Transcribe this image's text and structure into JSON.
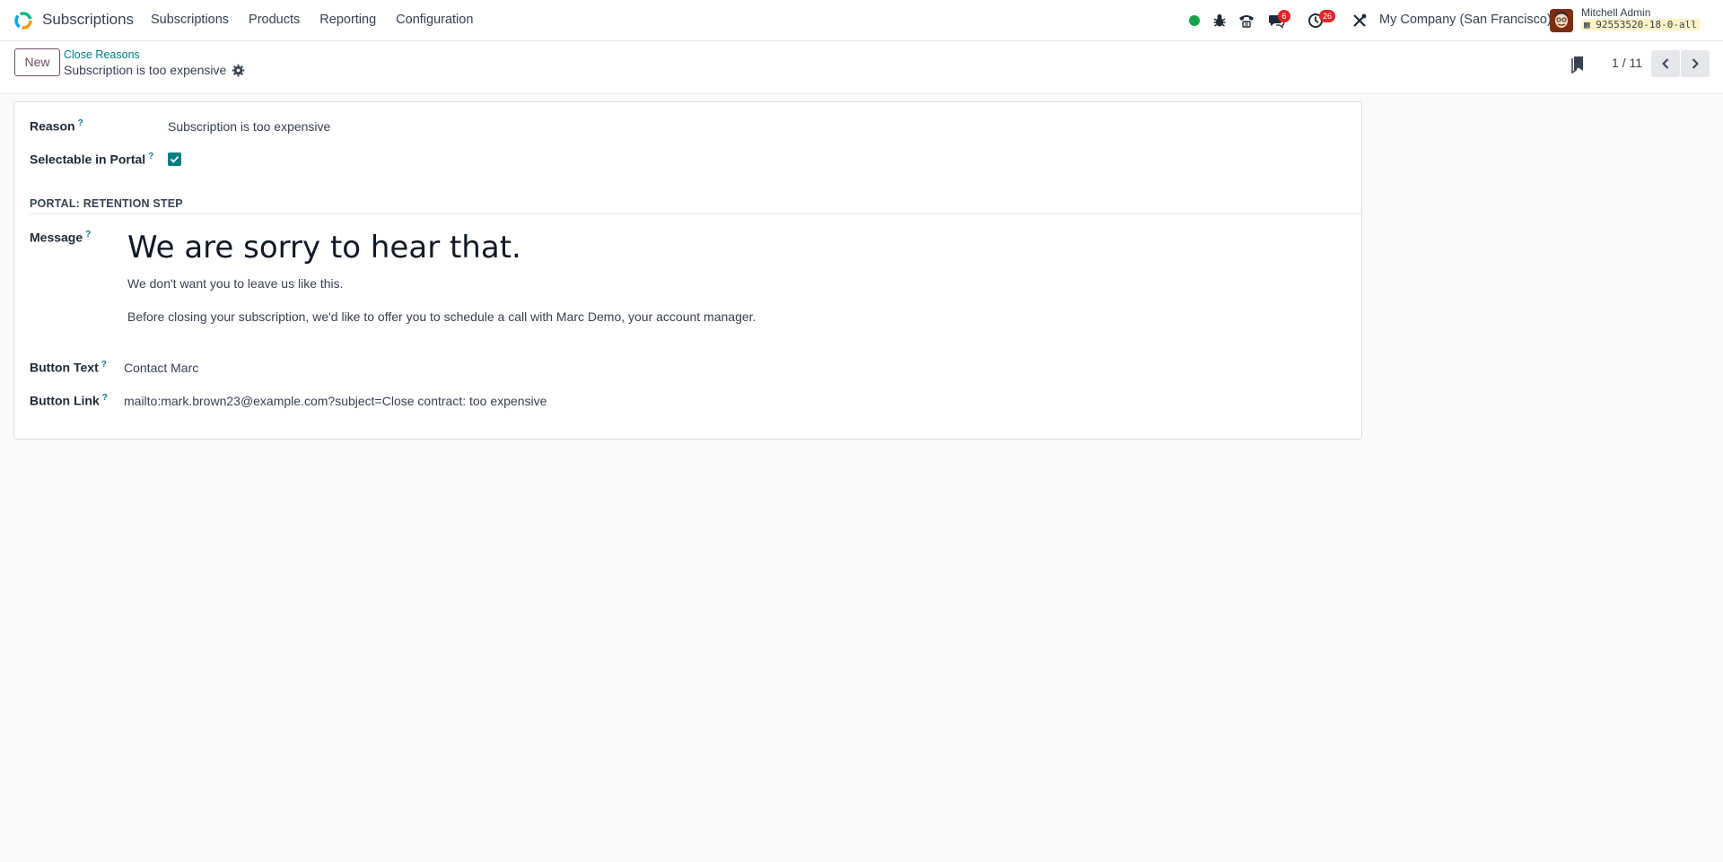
{
  "navbar": {
    "app_name": "Subscriptions",
    "menu": [
      "Subscriptions",
      "Products",
      "Reporting",
      "Configuration"
    ],
    "chat_badge": "6",
    "activity_badge": "26",
    "company": "My Company (San Francisco)",
    "user_name": "Mitchell Admin",
    "db_name": "92553520-18-0-all",
    "status_color": "#16a34a"
  },
  "control_panel": {
    "new_label": "New",
    "breadcrumb": "Close Reasons",
    "record_title": "Subscription is too expensive",
    "pager": "1 / 11"
  },
  "form": {
    "reason_label": "Reason",
    "reason_value": "Subscription is too expensive",
    "portal_label": "Selectable in Portal",
    "portal_checked": true,
    "section_title": "PORTAL: RETENTION STEP",
    "message_label": "Message",
    "message_heading": "We are sorry to hear that.",
    "message_p1": "We don't want you to leave us like this.",
    "message_p2": "Before closing your subscription, we'd like to offer you to schedule a call with Marc Demo, your account manager.",
    "button_text_label": "Button Text",
    "button_text_value": "Contact Marc",
    "button_link_label": "Button Link",
    "button_link_value": "mailto:mark.brown23@example.com?subject=Close contract: too expensive"
  },
  "colors": {
    "accent": "#017e84",
    "brand": "#714b67",
    "badge": "#dc2626"
  }
}
